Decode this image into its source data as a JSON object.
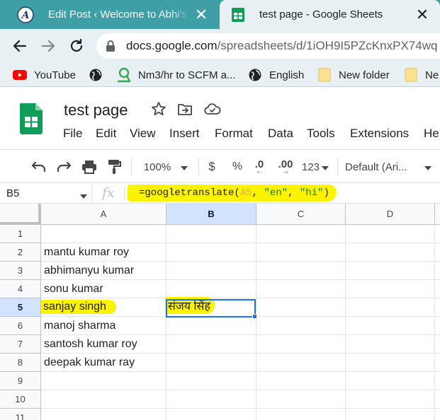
{
  "browser": {
    "tabs": [
      {
        "title": "Edit Post ‹ Welcome to Abhi's Blog",
        "close": "✕",
        "active": false
      },
      {
        "title": "test page - Google Sheets",
        "close": "✕",
        "active": true
      }
    ],
    "url_host": "docs.google.com",
    "url_path": "/spreadsheets/d/1iOH9I5PZcKnxPX74wq",
    "bookmarks": [
      {
        "label": "YouTube",
        "icon": "youtube-icon"
      },
      {
        "label": "",
        "icon": "globe-icon"
      },
      {
        "label": "Nm3/hr to SCFM a...",
        "icon": "converter-icon"
      },
      {
        "label": "English",
        "icon": "globe-icon"
      },
      {
        "label": "New folder",
        "icon": "folder-icon"
      },
      {
        "label": "Ne",
        "icon": "folder-icon"
      }
    ]
  },
  "sheets": {
    "doc_title": "test page",
    "menu": [
      "File",
      "Edit",
      "View",
      "Insert",
      "Format",
      "Data",
      "Tools",
      "Extensions",
      "He"
    ],
    "toolbar": {
      "zoom": "100%",
      "currency": "$",
      "percent": "%",
      "decimal_decrease": ".0",
      "decimal_increase": ".00",
      "number_format": "123",
      "font": "Default (Ari..."
    },
    "formula_bar": {
      "name_box": "B5",
      "fx": "fx",
      "formula_prefix": "=googletranslate(",
      "formula_ref": "A5",
      "formula_sep1": ", ",
      "formula_arg1": "\"en\"",
      "formula_sep2": ", ",
      "formula_arg2": "\"hi\"",
      "formula_suffix": ")"
    },
    "columns": [
      "A",
      "B",
      "C",
      "D"
    ],
    "selected_cell": "B5",
    "rows": [
      {
        "num": "1",
        "a": "",
        "b": ""
      },
      {
        "num": "2",
        "a": "mantu kumar roy",
        "b": ""
      },
      {
        "num": "3",
        "a": "abhimanyu kumar",
        "b": ""
      },
      {
        "num": "4",
        "a": "sonu kumar",
        "b": ""
      },
      {
        "num": "5",
        "a": "sanjay singh",
        "b": "संजय सिंह"
      },
      {
        "num": "6",
        "a": "manoj sharma",
        "b": ""
      },
      {
        "num": "7",
        "a": "santosh kumar roy",
        "b": ""
      },
      {
        "num": "8",
        "a": "deepak kumar ray",
        "b": ""
      },
      {
        "num": "9",
        "a": "",
        "b": ""
      },
      {
        "num": "10",
        "a": "",
        "b": ""
      },
      {
        "num": "11",
        "a": "",
        "b": ""
      }
    ],
    "colors": {
      "highlight": "#fbf300",
      "selection": "#1a73e8",
      "tabstrip": "#3f9fa6",
      "sheets_green": "#0f9d58"
    }
  }
}
